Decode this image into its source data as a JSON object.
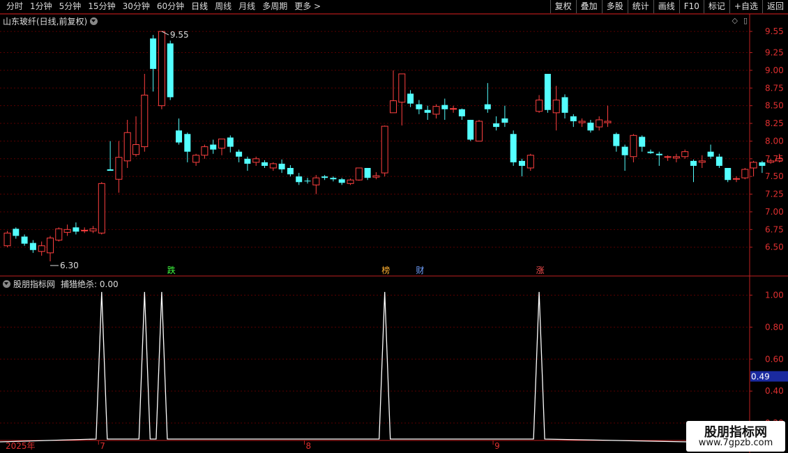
{
  "toolbar": {
    "periods": [
      "分时",
      "1分钟",
      "5分钟",
      "15分钟",
      "30分钟",
      "60分钟",
      "日线",
      "周线",
      "月线",
      "多周期",
      "更多 >"
    ],
    "buttons": [
      "复权",
      "叠加",
      "多股",
      "统计",
      "画线",
      "F10",
      "标记",
      "+自选",
      "返回"
    ]
  },
  "stock": {
    "title": "山东玻纤(日线,前复权)"
  },
  "indicator": {
    "name": "股朋指标网",
    "label": "捕猎绝杀: 0.00",
    "current_value_label": "0.49"
  },
  "watermark": {
    "name": "股朋指标网",
    "url": "www.7gpzb.com"
  },
  "colors": {
    "up": "#ff4040",
    "down": "#54ffff",
    "grid": "#5a0000",
    "axis": "#c02020",
    "line": "#ffffff"
  },
  "chart_data": [
    {
      "type": "candlestick",
      "ylim": [
        6.3,
        9.6
      ],
      "y_ticks": [
        "9.55",
        "9.25",
        "9.00",
        "8.75",
        "8.50",
        "8.25",
        "8.00",
        "7.75",
        "7.50",
        "7.25",
        "7.00",
        "6.75",
        "6.50"
      ],
      "high_marker": "9.55",
      "low_marker": "6.30",
      "candles": [
        [
          6.52,
          6.7,
          6.73,
          6.5
        ],
        [
          6.76,
          6.66,
          6.78,
          6.62
        ],
        [
          6.65,
          6.55,
          6.68,
          6.52
        ],
        [
          6.56,
          6.46,
          6.6,
          6.42
        ],
        [
          6.44,
          6.52,
          6.58,
          6.38
        ],
        [
          6.42,
          6.63,
          6.66,
          6.3
        ],
        [
          6.6,
          6.76,
          6.78,
          6.58
        ],
        [
          6.71,
          6.75,
          6.82,
          6.66
        ],
        [
          6.78,
          6.72,
          6.85,
          6.68
        ],
        [
          6.74,
          6.74,
          6.78,
          6.7
        ],
        [
          6.73,
          6.76,
          6.8,
          6.7
        ],
        [
          6.7,
          7.4,
          7.42,
          6.68
        ],
        [
          7.6,
          7.58,
          8.0,
          7.58
        ],
        [
          7.46,
          7.77,
          8.0,
          7.27
        ],
        [
          7.72,
          8.12,
          8.3,
          7.62
        ],
        [
          7.81,
          7.95,
          8.35,
          7.78
        ],
        [
          7.92,
          8.65,
          8.95,
          7.85
        ],
        [
          9.45,
          9.02,
          9.5,
          8.7
        ],
        [
          8.5,
          9.55,
          9.55,
          8.45
        ],
        [
          9.38,
          8.62,
          9.42,
          8.58
        ],
        [
          8.15,
          7.98,
          8.32,
          7.95
        ],
        [
          8.1,
          7.85,
          8.12,
          7.7
        ],
        [
          7.7,
          7.8,
          7.82,
          7.65
        ],
        [
          7.8,
          7.92,
          7.95,
          7.75
        ],
        [
          7.95,
          7.88,
          8.02,
          7.82
        ],
        [
          7.9,
          8.03,
          8.03,
          7.8
        ],
        [
          8.05,
          7.92,
          8.08,
          7.84
        ],
        [
          7.85,
          7.78,
          7.88,
          7.7
        ],
        [
          7.75,
          7.68,
          7.78,
          7.58
        ],
        [
          7.7,
          7.75,
          7.78,
          7.65
        ],
        [
          7.7,
          7.65,
          7.73,
          7.62
        ],
        [
          7.62,
          7.68,
          7.7,
          7.58
        ],
        [
          7.68,
          7.6,
          7.74,
          7.55
        ],
        [
          7.62,
          7.53,
          7.66,
          7.5
        ],
        [
          7.5,
          7.42,
          7.55,
          7.38
        ],
        [
          7.44,
          7.43,
          7.48,
          7.4
        ],
        [
          7.38,
          7.48,
          7.52,
          7.25
        ],
        [
          7.5,
          7.48,
          7.52,
          7.45
        ],
        [
          7.48,
          7.46,
          7.5,
          7.43
        ],
        [
          7.46,
          7.41,
          7.48,
          7.38
        ],
        [
          7.4,
          7.45,
          7.47,
          7.38
        ],
        [
          7.45,
          7.62,
          7.62,
          7.44
        ],
        [
          7.62,
          7.48,
          7.62,
          7.45
        ],
        [
          7.49,
          7.51,
          7.56,
          7.46
        ],
        [
          7.55,
          8.21,
          8.22,
          7.5
        ],
        [
          8.4,
          8.57,
          9.0,
          8.4
        ],
        [
          8.55,
          8.95,
          8.95,
          8.22
        ],
        [
          8.67,
          8.53,
          8.72,
          8.48
        ],
        [
          8.52,
          8.45,
          8.58,
          8.38
        ],
        [
          8.44,
          8.4,
          8.5,
          8.3
        ],
        [
          8.38,
          8.49,
          8.52,
          8.32
        ],
        [
          8.51,
          8.45,
          8.6,
          8.3
        ],
        [
          8.45,
          8.46,
          8.5,
          8.4
        ],
        [
          8.45,
          8.35,
          8.46,
          8.3
        ],
        [
          8.3,
          8.02,
          8.3,
          8.0
        ],
        [
          8.0,
          8.28,
          8.3,
          8.0
        ],
        [
          8.52,
          8.45,
          8.82,
          8.4
        ],
        [
          8.25,
          8.2,
          8.35,
          8.15
        ],
        [
          8.32,
          8.26,
          8.5,
          8.2
        ],
        [
          8.1,
          7.7,
          8.15,
          7.65
        ],
        [
          7.72,
          7.65,
          7.75,
          7.5
        ],
        [
          7.62,
          7.8,
          7.82,
          7.58
        ],
        [
          8.42,
          8.58,
          8.65,
          8.4
        ],
        [
          8.95,
          8.44,
          8.95,
          8.4
        ],
        [
          8.4,
          8.58,
          8.78,
          8.15
        ],
        [
          8.62,
          8.4,
          8.66,
          8.32
        ],
        [
          8.35,
          8.28,
          8.38,
          8.2
        ],
        [
          8.26,
          8.28,
          8.32,
          8.2
        ],
        [
          8.26,
          8.15,
          8.3,
          8.12
        ],
        [
          8.2,
          8.3,
          8.35,
          8.15
        ],
        [
          8.26,
          8.28,
          8.5,
          8.2
        ],
        [
          8.1,
          7.93,
          8.12,
          7.85
        ],
        [
          7.92,
          7.8,
          7.95,
          7.58
        ],
        [
          7.78,
          8.08,
          8.1,
          7.7
        ],
        [
          8.06,
          7.92,
          8.08,
          7.85
        ],
        [
          7.85,
          7.83,
          7.88,
          7.82
        ],
        [
          7.82,
          7.8,
          7.85,
          7.65
        ],
        [
          7.78,
          7.78,
          7.8,
          7.72
        ],
        [
          7.76,
          7.78,
          7.82,
          7.7
        ],
        [
          7.78,
          7.85,
          7.88,
          7.75
        ],
        [
          7.72,
          7.65,
          7.74,
          7.42
        ],
        [
          7.7,
          7.72,
          7.8,
          7.62
        ],
        [
          7.85,
          7.78,
          7.95,
          7.75
        ],
        [
          7.78,
          7.65,
          7.82,
          7.62
        ],
        [
          7.62,
          7.45,
          7.62,
          7.42
        ],
        [
          7.47,
          7.47,
          7.5,
          7.42
        ],
        [
          7.48,
          7.6,
          7.62,
          7.46
        ],
        [
          7.62,
          7.7,
          7.72,
          7.5
        ],
        [
          7.7,
          7.65,
          7.72,
          7.55
        ],
        [
          7.7,
          7.72,
          7.75,
          7.68
        ],
        [
          7.72,
          7.75,
          7.82,
          7.7
        ]
      ],
      "signal_labels": [
        {
          "text": "跌",
          "index": 19
        },
        {
          "text": "榜",
          "index": 44
        },
        {
          "text": "财",
          "index": 48
        },
        {
          "text": "涨",
          "index": 62
        }
      ]
    },
    {
      "type": "line",
      "name": "捕猎绝杀",
      "ylim": [
        0.1,
        1.05
      ],
      "y_ticks": [
        "1.00",
        "0.80",
        "0.60",
        "0.40",
        "0.20"
      ],
      "spike_indices": [
        11,
        16,
        18,
        44,
        62
      ],
      "x_labels": [
        {
          "text": "2025年",
          "index": 0
        },
        {
          "text": "7",
          "index": 11
        },
        {
          "text": "8",
          "index": 35
        },
        {
          "text": "9",
          "index": 57
        },
        {
          "text": "10",
          "index": 80
        }
      ]
    }
  ]
}
